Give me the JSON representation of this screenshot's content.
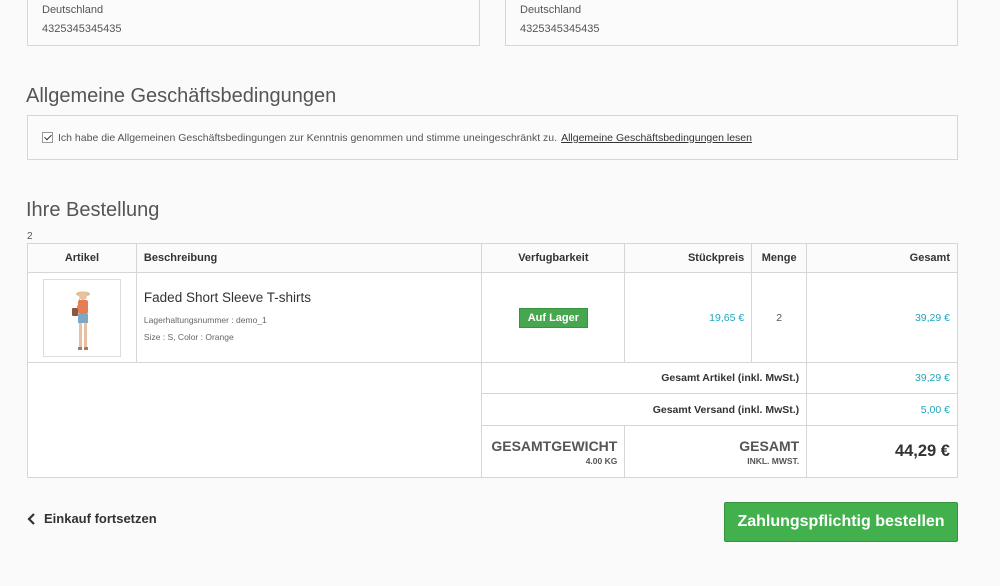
{
  "address_left": {
    "country": "Deutschland",
    "phone": "4325345345435"
  },
  "address_right": {
    "country": "Deutschland",
    "phone": "4325345345435"
  },
  "terms": {
    "heading": "Allgemeine Geschäftsbedingungen",
    "accept_text": "Ich habe die Allgemeinen Geschäftsbedingungen zur Kenntnis genommen und stimme uneingeschränkt zu.",
    "link": "Allgemeine Geschäftsbedingungen lesen",
    "checked": true
  },
  "order": {
    "heading": "Ihre Bestellung",
    "item_count": "2",
    "columns": [
      "Artikel",
      "Beschreibung",
      "Verfugbarkeit",
      "Stückpreis",
      "Menge",
      "Gesamt"
    ],
    "items": [
      {
        "name": "Faded Short Sleeve T-shirts",
        "sku": "Lagerhaltungsnummer : demo_1",
        "attributes": "Size : S, Color : Orange",
        "availability": "Auf Lager",
        "unit_price": "19,65 €",
        "quantity": "2",
        "total": "39,29 €"
      }
    ],
    "summary": {
      "articles_label": "Gesamt Artikel (inkl. MwSt.)",
      "articles_value": "39,29 €",
      "shipping_label": "Gesamt Versand (inkl. MwSt.)",
      "shipping_value": "5,00 €",
      "weight_label": "GESAMTGEWICHT",
      "weight_value": "4.00 KG",
      "total_label": "GESAMT",
      "total_sub": "INKL. MWST.",
      "total_value": "44,29 €"
    }
  },
  "actions": {
    "continue": "Einkauf fortsetzen",
    "order": "Zahlungspflichtig bestellen"
  },
  "colors": {
    "accent": "#1fa7ba",
    "success": "#42b14d"
  }
}
